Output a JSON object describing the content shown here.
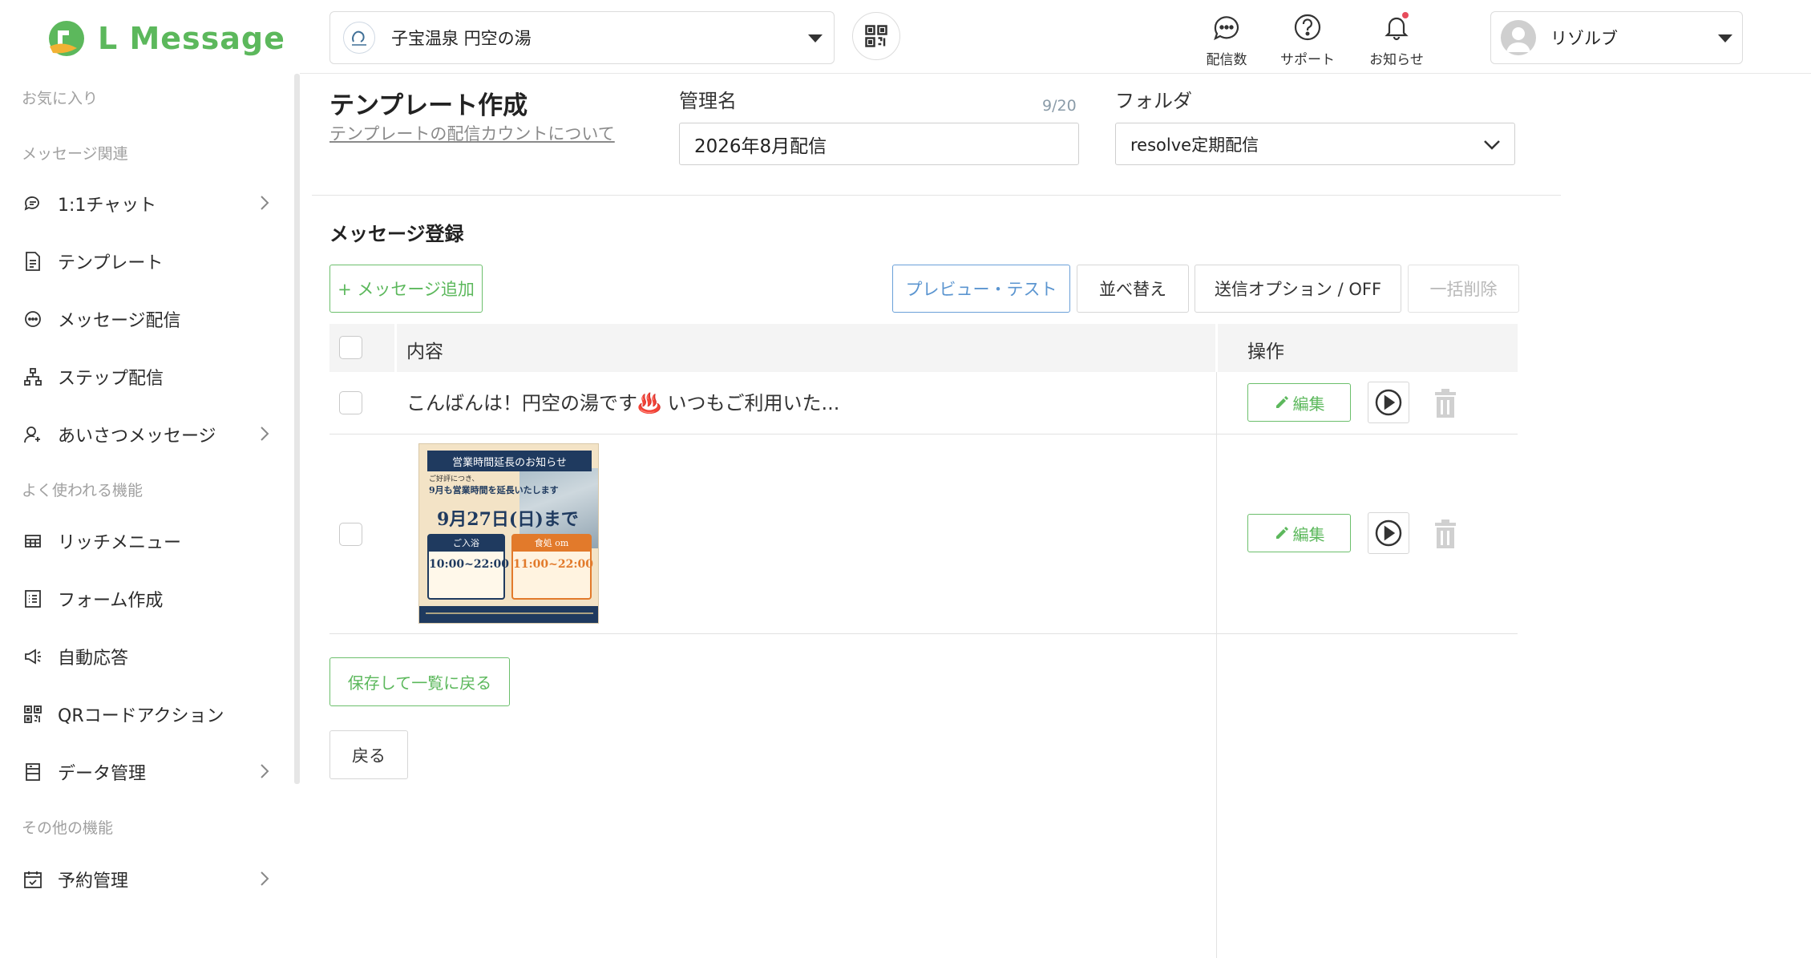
{
  "app": {
    "logo_text": "L Message",
    "brand_color": "#5cb85c"
  },
  "sidebar": {
    "sections": {
      "favorites": "お気に入り",
      "message": "メッセージ関連",
      "frequent": "よく使われる機能",
      "other": "その他の機能"
    },
    "items": [
      {
        "label": "1:1チャット",
        "icon": "chat-bubble-icon",
        "has_chevron": true
      },
      {
        "label": "テンプレート",
        "icon": "document-icon",
        "has_chevron": false
      },
      {
        "label": "メッセージ配信",
        "icon": "message-icon",
        "has_chevron": false
      },
      {
        "label": "ステップ配信",
        "icon": "hierarchy-icon",
        "has_chevron": false
      },
      {
        "label": "あいさつメッセージ",
        "icon": "user-plus-icon",
        "has_chevron": true
      },
      {
        "label": "リッチメニュー",
        "icon": "grid-table-icon",
        "has_chevron": false
      },
      {
        "label": "フォーム作成",
        "icon": "form-list-icon",
        "has_chevron": false
      },
      {
        "label": "自動応答",
        "icon": "megaphone-icon",
        "has_chevron": false
      },
      {
        "label": "QRコードアクション",
        "icon": "qr-code-icon",
        "has_chevron": false
      },
      {
        "label": "データ管理",
        "icon": "database-icon",
        "has_chevron": true
      },
      {
        "label": "予約管理",
        "icon": "calendar-icon",
        "has_chevron": true
      }
    ]
  },
  "topbar": {
    "account_name": "子宝温泉 円空の湯",
    "icons": [
      {
        "label": "配信数",
        "icon": "message-count-icon"
      },
      {
        "label": "サポート",
        "icon": "help-icon"
      },
      {
        "label": "お知らせ",
        "icon": "bell-icon"
      }
    ],
    "user_name": "リゾルブ",
    "notification_color": "#e74c5c"
  },
  "form": {
    "title": "テンプレート作成",
    "help_link": "テンプレートの配信カウントについて",
    "name_label": "管理名",
    "name_counter": "9/20",
    "name_value": "2026年8月配信",
    "folder_label": "フォルダ",
    "folder_value": "resolve定期配信"
  },
  "messages": {
    "section_title": "メッセージ登録",
    "add_button": "+ メッセージ追加",
    "preview_button": "プレビュー・テスト",
    "sort_button": "並べ替え",
    "send_option_button": "送信オプション / OFF",
    "bulk_delete_button": "一括削除",
    "col_content": "内容",
    "col_actions": "操作",
    "edit_label": "編集",
    "rows": [
      {
        "type": "text",
        "content": "こんばんは！円空の湯です♨️ いつもご利用いた..."
      },
      {
        "type": "image"
      }
    ]
  },
  "poster": {
    "banner": "営業時間延長のお知らせ",
    "sub_line1": "ご好評につき、",
    "sub_line2": "9月も営業時間を延長いたします",
    "date": "9月27日(日)まで",
    "box1_head": "ご入浴",
    "box1_time": "10:00~22:00",
    "box2_head": "食処 om",
    "box2_time": "11:00~22:00"
  },
  "footer_buttons": {
    "save": "保存して一覧に戻る",
    "back": "戻る"
  }
}
